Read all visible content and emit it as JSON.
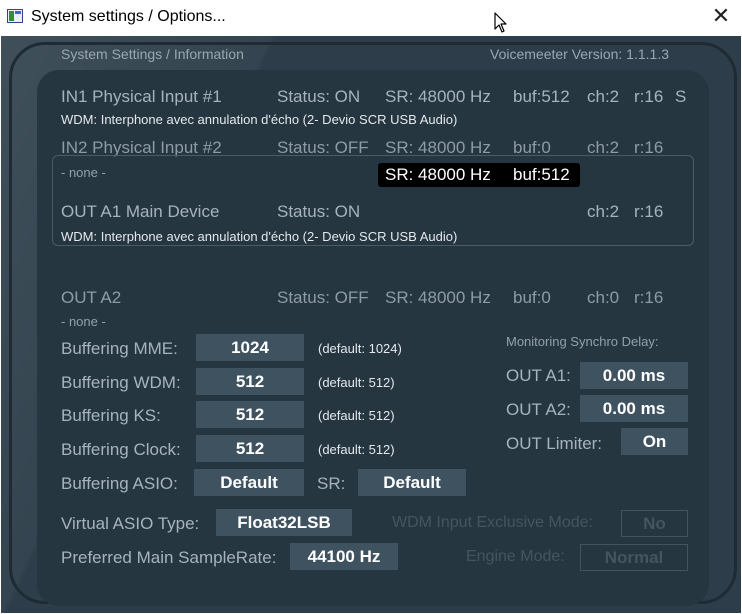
{
  "titlebar": {
    "title": "System settings / Options...",
    "close_glyph": "✕"
  },
  "header": {
    "left": "System Settings / Information",
    "version": "Voicemeeter Version: 1.1.1.3"
  },
  "devices": [
    {
      "name": "IN1 Physical Input #1",
      "status": "Status: ON",
      "sr": "SR: 48000 Hz",
      "buf": "buf:512",
      "ch": "ch:2",
      "r": "r:16",
      "extra": "S",
      "detail": "WDM: Interphone avec annulation d'écho (2- Devio SCR USB Audio)"
    },
    {
      "name": "IN2 Physical Input #2",
      "status": "Status: OFF",
      "sr": "SR: 48000 Hz",
      "buf": "buf:0",
      "ch": "ch:2",
      "r": "r:16",
      "detail": "- none -"
    },
    {
      "name": "OUT A1 Main Device",
      "status": "Status: ON",
      "sr": "SR: 48000 Hz",
      "buf": "buf:512",
      "ch": "ch:2",
      "r": "r:16",
      "detail": "WDM: Interphone avec annulation d'écho (2- Devio SCR USB Audio)"
    },
    {
      "name": "OUT A2",
      "status": "Status: OFF",
      "sr": "SR: 48000 Hz",
      "buf": "buf:0",
      "ch": "ch:0",
      "r": "r:16",
      "detail": "- none -"
    }
  ],
  "buffering": [
    {
      "label": "Buffering MME:",
      "value": "1024",
      "default": "(default: 1024)"
    },
    {
      "label": "Buffering WDM:",
      "value": "512",
      "default": "(default: 512)"
    },
    {
      "label": "Buffering KS:",
      "value": "512",
      "default": "(default: 512)"
    },
    {
      "label": "Buffering Clock:",
      "value": "512",
      "default": "(default: 512)"
    }
  ],
  "asio": {
    "label": "Buffering ASIO:",
    "value": "Default",
    "sr_label": "SR:",
    "sr_value": "Default"
  },
  "monitoring": {
    "title": "Monitoring Synchro Delay:",
    "a1_label": "OUT A1:",
    "a1_value": "0.00 ms",
    "a2_label": "OUT A2:",
    "a2_value": "0.00 ms",
    "limiter_label": "OUT Limiter:",
    "limiter_value": "On"
  },
  "virtual_asio": {
    "label": "Virtual ASIO Type:",
    "value": "Float32LSB"
  },
  "preferred_sr": {
    "label": "Preferred Main SampleRate:",
    "value": "44100 Hz"
  },
  "wdm_exclusive": {
    "label": "WDM Input Exclusive Mode:",
    "value": "No"
  },
  "engine_mode": {
    "label": "Engine Mode:",
    "value": "Normal"
  },
  "colors": {
    "background": "#2d3e4a",
    "panel": "#263641",
    "button": "#3f5260",
    "highlight": "#000000"
  }
}
